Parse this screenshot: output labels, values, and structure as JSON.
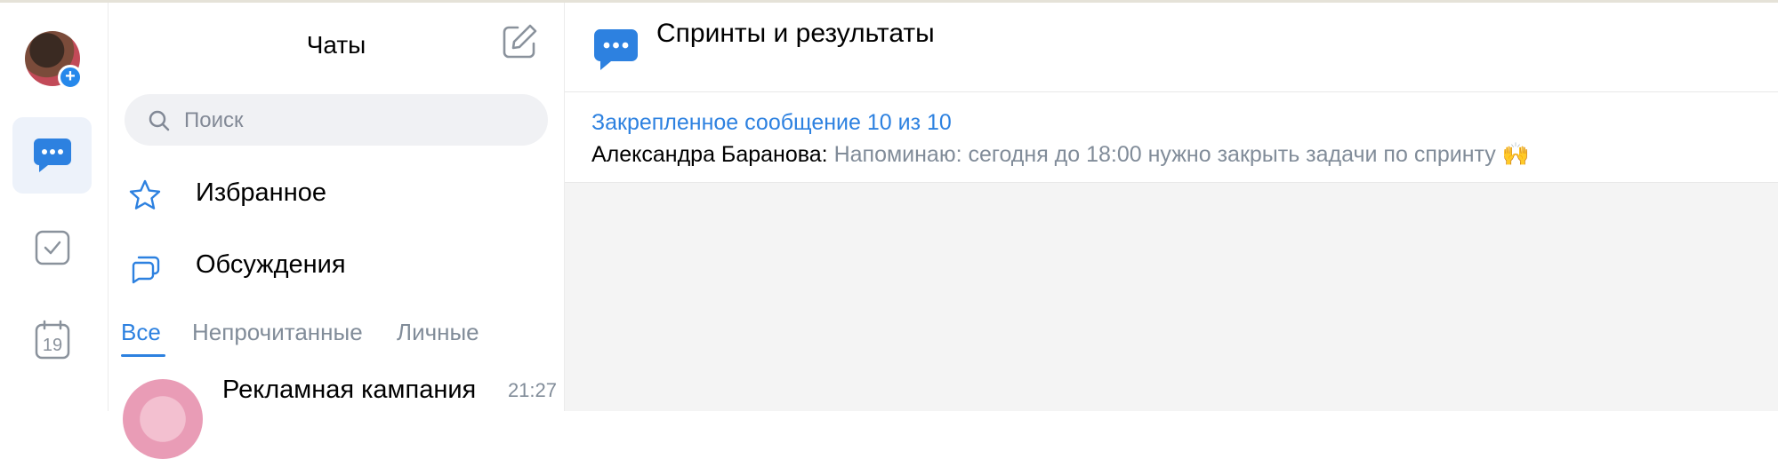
{
  "chats_panel": {
    "title": "Чаты",
    "search_placeholder": "Поиск",
    "menu": [
      {
        "label": "Избранное",
        "icon": "star-icon"
      },
      {
        "label": "Обсуждения",
        "icon": "discussions-icon"
      }
    ],
    "tabs": [
      "Все",
      "Непрочитанные",
      "Личные"
    ],
    "active_tab": "Все",
    "chat_list": [
      {
        "name": "Рекламная кампания",
        "time": "21:27"
      }
    ]
  },
  "rail": {
    "calendar_day": "19",
    "items": [
      "chat-icon",
      "tasks-icon",
      "calendar-icon"
    ]
  },
  "conversation": {
    "title": "Спринты и результаты",
    "subtitle": "",
    "pinned": {
      "header": "Закрепленное сообщение 10 из 10",
      "author": "Александра Баранова:",
      "text": " Напоминаю: сегодня до 18:00 нужно закрыть задачи по спринту 🙌"
    }
  },
  "colors": {
    "accent": "#2d81e0",
    "muted": "#818c99",
    "background": "#f4f4f4"
  }
}
